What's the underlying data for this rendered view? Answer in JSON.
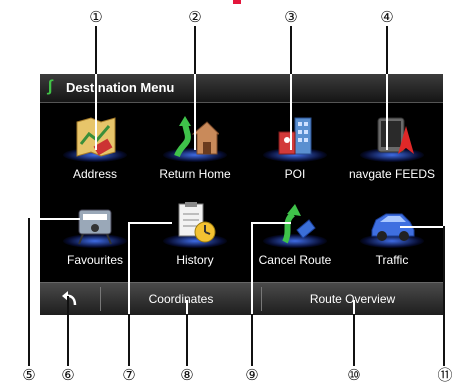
{
  "callouts": [
    "①",
    "②",
    "③",
    "④",
    "⑤",
    "⑥",
    "⑦",
    "⑧",
    "⑨",
    "⑩",
    "⑪"
  ],
  "title": {
    "icon": "route-icon",
    "text": "Destination Menu"
  },
  "menu_items": [
    {
      "label": "Address",
      "icon": "address-map-icon"
    },
    {
      "label": "Return Home",
      "icon": "return-home-icon"
    },
    {
      "label": "POI",
      "icon": "poi-building-icon"
    },
    {
      "label": "navgate FEEDS",
      "icon": "navgate-feeds-icon"
    },
    {
      "label": "Favourites",
      "icon": "favourites-icon"
    },
    {
      "label": "History",
      "icon": "history-icon"
    },
    {
      "label": "Cancel Route",
      "icon": "cancel-route-icon"
    },
    {
      "label": "Traffic",
      "icon": "traffic-car-icon"
    }
  ],
  "bottom_bar": {
    "back_icon": "back-arrow-icon",
    "coordinates": "Coordinates",
    "route_overview": "Route Overview"
  },
  "colors": {
    "screen_bg": "#000000",
    "accent_green": "#41c447",
    "glow_blue": "#4678ff",
    "top_marker": "#e3153b"
  }
}
